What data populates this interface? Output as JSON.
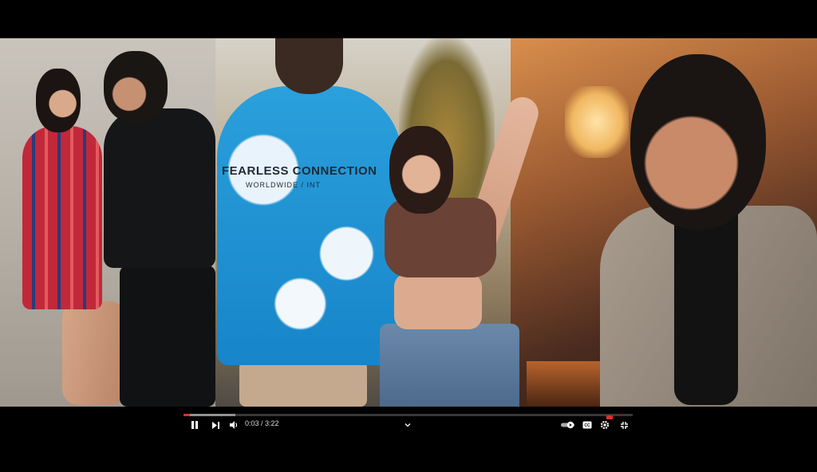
{
  "video": {
    "shirt_print": "FEARLESS CONNECTION",
    "shirt_print_sub": "WORLDWIDE / INT"
  },
  "player": {
    "current_time": "0:03",
    "separator": " / ",
    "duration": "3:22",
    "progress_played": 0.015,
    "progress_loaded": 0.115,
    "accent_color": "#e52d27"
  },
  "icons": [
    "pause-icon",
    "next-icon",
    "volume-icon",
    "chevron-down-icon",
    "autoplay-toggle-icon",
    "captions-icon",
    "settings-icon",
    "fullscreen-exit-icon"
  ]
}
